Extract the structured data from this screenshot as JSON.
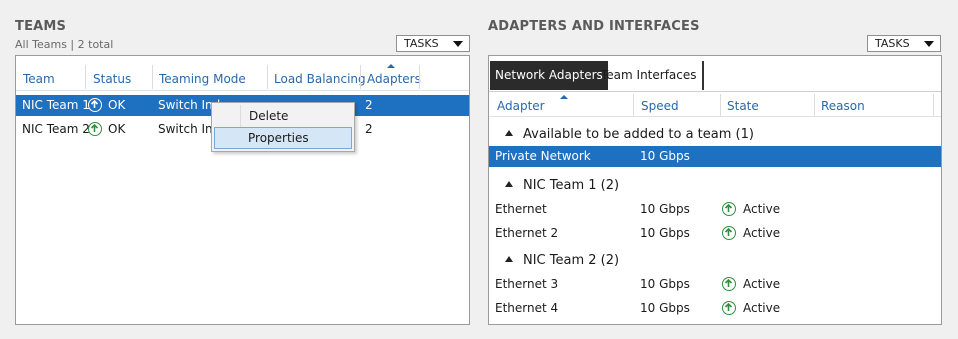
{
  "teams": {
    "title": "TEAMS",
    "subtitle": "All Teams | 2 total",
    "tasks_label": "TASKS",
    "columns": [
      "Team",
      "Status",
      "Teaming Mode",
      "Load Balancing",
      "Adapters"
    ],
    "rows": [
      {
        "team": "NIC Team 1",
        "status": "OK",
        "mode": "Switch Ind",
        "adapters": "2",
        "selected": true
      },
      {
        "team": "NIC Team 2",
        "status": "OK",
        "mode": "Switch Ind",
        "adapters": "2",
        "selected": false
      }
    ],
    "context_menu": {
      "items": [
        "Delete",
        "Properties"
      ],
      "hovered": "Properties"
    }
  },
  "adapters": {
    "title": "ADAPTERS AND INTERFACES",
    "tasks_label": "TASKS",
    "tabs": [
      "Network Adapters",
      "Team Interfaces"
    ],
    "active_tab": "Network Adapters",
    "columns": [
      "Adapter",
      "Speed",
      "State",
      "Reason"
    ],
    "groups": [
      {
        "label": "Available to be added to a team (1)",
        "rows": [
          {
            "adapter": "Private Network",
            "speed": "10 Gbps",
            "state": "",
            "selected": true
          }
        ]
      },
      {
        "label": "NIC Team 1 (2)",
        "rows": [
          {
            "adapter": "Ethernet",
            "speed": "10 Gbps",
            "state": "Active"
          },
          {
            "adapter": "Ethernet 2",
            "speed": "10 Gbps",
            "state": "Active"
          }
        ]
      },
      {
        "label": "NIC Team 2 (2)",
        "rows": [
          {
            "adapter": "Ethernet 3",
            "speed": "10 Gbps",
            "state": "Active"
          },
          {
            "adapter": "Ethernet 4",
            "speed": "10 Gbps",
            "state": "Active"
          }
        ]
      }
    ]
  },
  "colors": {
    "selection": "#1e70c0",
    "link": "#2a68a8",
    "ok": "#2f8f3f"
  }
}
